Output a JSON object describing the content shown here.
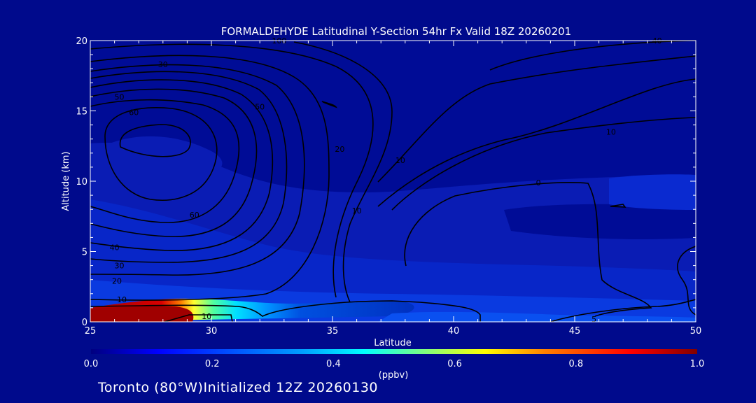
{
  "chart_data": {
    "type": "contour",
    "title": "FORMALDEHYDE Latitudinal Y-Section 54hr  Fx Valid 18Z 20260201",
    "xlabel": "Latitude",
    "ylabel": "Altitude (km)",
    "xlim": [
      25,
      50
    ],
    "ylim": [
      0,
      20
    ],
    "x_ticks": [
      25,
      30,
      35,
      40,
      45,
      50
    ],
    "y_ticks": [
      0,
      5,
      10,
      15,
      20
    ],
    "colorbar": {
      "label": "(ppbv)",
      "min": 0.0,
      "max": 1.0,
      "ticks": [
        "0.0",
        "0.2",
        "0.4",
        "0.6",
        "0.8",
        "1.0"
      ],
      "colors": [
        "#00007f",
        "#0000ff",
        "#00a0ff",
        "#00ffff",
        "#7fff7f",
        "#ffff00",
        "#ff7f00",
        "#ff0000",
        "#7f0000"
      ]
    },
    "contour_labels": [
      {
        "text": "10",
        "lat": 29.8,
        "alt": 0.4
      },
      {
        "text": "10",
        "lat": 26.3,
        "alt": 1.6
      },
      {
        "text": "20",
        "lat": 26.1,
        "alt": 2.9
      },
      {
        "text": "30",
        "lat": 26.2,
        "alt": 4.0
      },
      {
        "text": "40",
        "lat": 26.0,
        "alt": 5.3
      },
      {
        "text": "60",
        "lat": 29.3,
        "alt": 7.6
      },
      {
        "text": "10",
        "lat": 36.0,
        "alt": 7.9
      },
      {
        "text": "10",
        "lat": 37.8,
        "alt": 11.5
      },
      {
        "text": "20",
        "lat": 35.3,
        "alt": 12.3
      },
      {
        "text": "50",
        "lat": 32.0,
        "alt": 15.3
      },
      {
        "text": "60",
        "lat": 26.8,
        "alt": 14.9
      },
      {
        "text": "50",
        "lat": 26.2,
        "alt": 16.0
      },
      {
        "text": "30",
        "lat": 28.0,
        "alt": 18.3
      },
      {
        "text": "100",
        "lat": 32.8,
        "alt": 20.0
      },
      {
        "text": "10",
        "lat": 46.5,
        "alt": 13.5
      },
      {
        "text": "40",
        "lat": 48.4,
        "alt": 20.0
      },
      {
        "text": "0",
        "lat": 43.5,
        "alt": 9.9
      },
      {
        "text": "5",
        "lat": 45.8,
        "alt": 0.2
      }
    ]
  },
  "footer": {
    "location_text": "Toronto (80°W)Initialized 12Z 20260130"
  }
}
